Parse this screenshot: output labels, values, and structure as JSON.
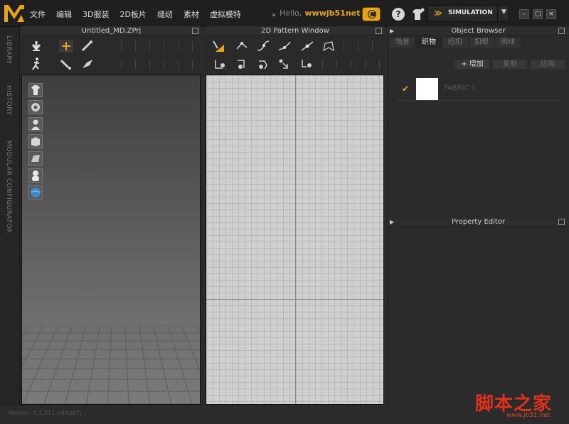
{
  "app": {
    "logo_label": "MD",
    "menus": [
      "文件",
      "编辑",
      "3D服装",
      "2D板片",
      "缝纫",
      "素材",
      "虚拟模特"
    ],
    "more_symbol": "»",
    "greeting": "Hello,",
    "username": "wwwjb51net",
    "mode": "SIMULATION",
    "mode_dropdown": "▼",
    "window_buttons": [
      "–",
      "□",
      "×"
    ],
    "help_symbol": "?"
  },
  "side_tabs": [
    "LIBRARY",
    "HISTORY",
    "MODULAR CONFIGURATOR"
  ],
  "panel3d": {
    "title": "Untitled_MD.ZPrj",
    "toolbar_row1": [
      "arrow-down-icon",
      "move-cross-icon",
      "pen-stitch-icon"
    ],
    "toolbar_row2": [
      "walk-figure-icon",
      "pin-icon",
      "fold-icon"
    ],
    "side_tools": [
      "shirt-icon",
      "gear-fabric-icon",
      "avatar-bust-icon",
      "garment-box-icon",
      "texture-icon",
      "silhouette-icon",
      "globe-icon"
    ]
  },
  "panel2d": {
    "title": "2D Pattern Window",
    "toolbar_row1": [
      "transform-pattern-icon",
      "edit-point-icon",
      "curve-point-icon",
      "bezier-icon",
      "add-point-icon",
      "polygon-icon"
    ],
    "toolbar_row2": [
      "segment-sew-icon",
      "free-sew-icon",
      "rotate-sew-icon",
      "arrange-icon",
      "dart-icon"
    ]
  },
  "object_browser": {
    "title": "Object Browser",
    "tabs": [
      {
        "label": "场景",
        "active": false
      },
      {
        "label": "织物",
        "active": true
      },
      {
        "label": "纽扣",
        "active": false
      },
      {
        "label": "扣眼",
        "active": false
      },
      {
        "label": "明线",
        "active": false
      }
    ],
    "add_label": "+ 增加",
    "copy_label": "复制",
    "apply_label": "应用",
    "items": [
      {
        "name": "FABRIC 1",
        "checked": true,
        "swatch_color": "#ffffff"
      }
    ]
  },
  "property_editor": {
    "title": "Property Editor"
  },
  "status": {
    "version": "Version: 5.1.311 (r44087)"
  },
  "watermark": {
    "text": "脚本之家",
    "url": "www.jb51.net"
  },
  "colors": {
    "accent": "#e8a317",
    "bg": "#2b2b2b",
    "watermark": "#e0301e"
  }
}
